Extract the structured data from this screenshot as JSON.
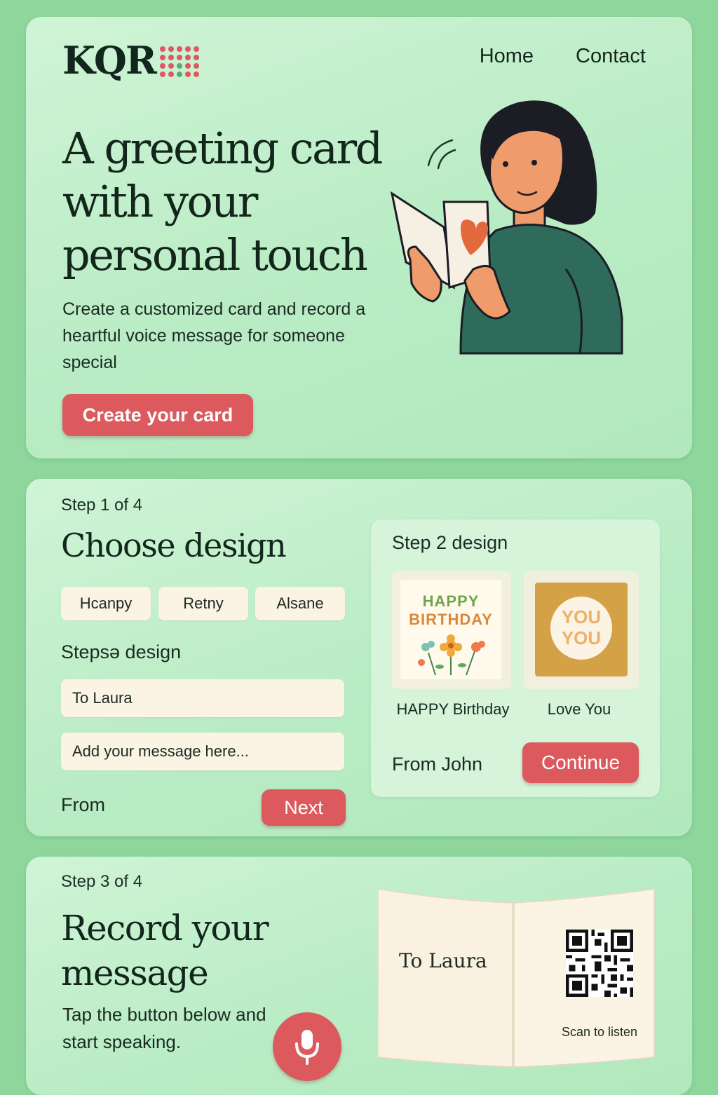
{
  "header": {
    "logo_text": "KQR",
    "nav": [
      {
        "label": "Home"
      },
      {
        "label": "Contact"
      }
    ]
  },
  "hero": {
    "title": "A greeting card with your personal touch",
    "subtitle": "Create a customized card and record a heartful voice message for someone special",
    "cta_label": "Create your card"
  },
  "step1": {
    "step_label": "Step 1 of 4",
    "title": "Choose design",
    "chips": [
      {
        "label": "Hcanpy"
      },
      {
        "label": "Retny"
      },
      {
        "label": "Alsane"
      }
    ],
    "step_design_label": "Stepsə design",
    "to_value": "To Laura",
    "message_placeholder": "Add your message here...",
    "from_label": "From",
    "next_label": "Next"
  },
  "step2": {
    "title": "Step 2 design",
    "designs": [
      {
        "label": "HAPPY Birthday",
        "art_line1": "HAPPY",
        "art_line2": "BIRTHDAY"
      },
      {
        "label": "Love You",
        "art_line1": "YOU",
        "art_line2": "YOU"
      }
    ],
    "from_value": "From John",
    "continue_label": "Continue"
  },
  "step3": {
    "step_label": "Step 3 of 4",
    "title_line1": "Record your",
    "title_line2": "message",
    "body": "Tap the button below and start speaking.",
    "card_to": "To Laura",
    "scan_label": "Scan to listen"
  },
  "colors": {
    "background": "#8ed69c",
    "panel": "#c6f0cf",
    "accent_red": "#dc5a5e",
    "cream": "#fbf3e4",
    "text_dark": "#13261c"
  },
  "icons": [
    "logo-dots-icon",
    "microphone-icon",
    "qr-code-icon",
    "heart-icon",
    "sound-waves-icon"
  ]
}
